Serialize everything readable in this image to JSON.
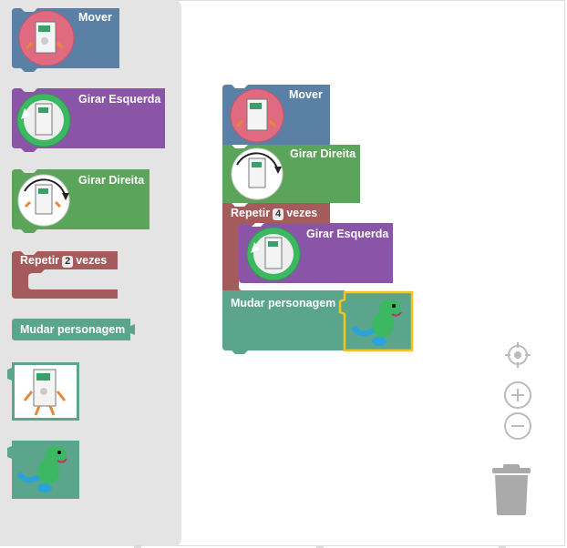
{
  "toolbox": {
    "blocks": [
      {
        "label": "Mover",
        "color": "#5b80a5"
      },
      {
        "label": "Girar Esquerda",
        "color": "#8a55a6"
      },
      {
        "label": "Girar Direita",
        "color": "#5ba55b"
      },
      {
        "label": "Repetir",
        "value": "2",
        "suffix": "vezes",
        "color": "#a55b5b"
      },
      {
        "label": "Mudar personagem",
        "color": "#5ba58c"
      }
    ],
    "images": [
      "robot-character-image",
      "dinosaur-character-image"
    ]
  },
  "workspace": {
    "mover": {
      "label": "Mover"
    },
    "girar_direita": {
      "label": "Girar Direita"
    },
    "repetir": {
      "label": "Repetir",
      "value": "4",
      "suffix": "vezes"
    },
    "girar_esquerda": {
      "label": "Girar Esquerda"
    },
    "mudar": {
      "label": "Mudar personagem"
    }
  },
  "controls": [
    "recenter-icon",
    "zoom-in-icon",
    "zoom-out-icon",
    "trash-icon"
  ]
}
